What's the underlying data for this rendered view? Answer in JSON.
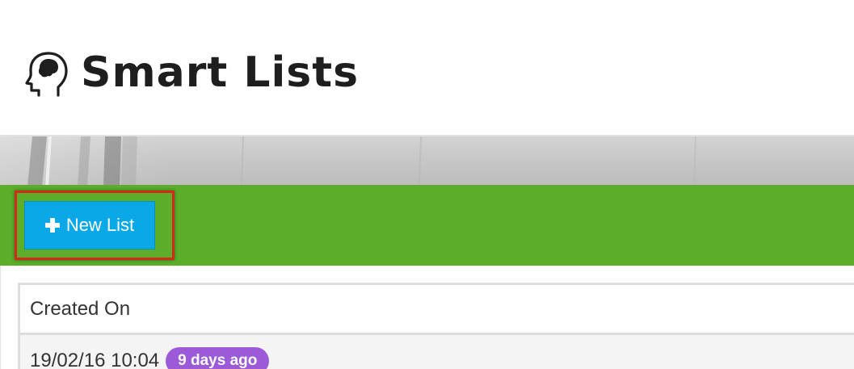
{
  "page": {
    "title": "Smart Lists",
    "title_icon": "head-brain-icon"
  },
  "toolbar": {
    "new_list_label": "New List",
    "new_list_icon": "plus-icon",
    "background_color": "#5cae2a",
    "button_color": "#0aa8e6",
    "highlight_color": "#d22b1b"
  },
  "table": {
    "columns": [
      "Created On"
    ],
    "rows": [
      {
        "created_on": "19/02/16 10:04",
        "age_badge": "9 days ago"
      }
    ],
    "badge_color": "#9c59d8"
  }
}
